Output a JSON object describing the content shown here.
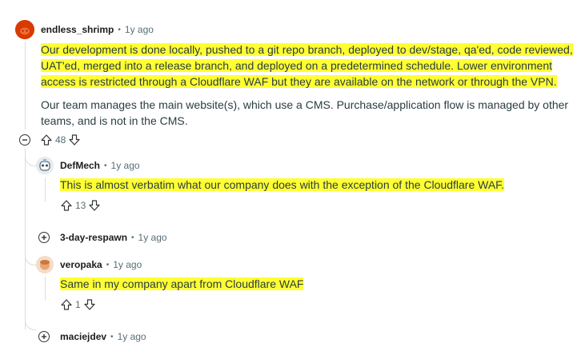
{
  "comments": [
    {
      "username": "endless_shrimp",
      "time": "1y ago",
      "para1_lines": [
        "Our development is done locally, pushed to a git repo branch, deployed to dev/stage, qa'ed, code reviewed,",
        "UAT'ed, merged into a release branch, and deployed on a predetermined schedule. Lower environment",
        "access is restricted through a Cloudflare WAF but they are available on the network or through the VPN."
      ],
      "para2_lines": [
        "Our team manages the main website(s), which use a CMS. Purchase/application flow is managed by other",
        "teams, and is not in the CMS."
      ],
      "votes": "48"
    },
    {
      "username": "DefMech",
      "time": "1y ago",
      "text": "This is almost verbatim what our company does with the exception of the Cloudflare WAF.",
      "votes": "13"
    },
    {
      "username": "3-day-respawn",
      "time": "1y ago"
    },
    {
      "username": "veropaka",
      "time": "1y ago",
      "text": "Same in my company apart from Cloudflare WAF",
      "votes": "1"
    },
    {
      "username": "maciejdev",
      "time": "1y ago"
    }
  ],
  "icons": {
    "upvote": "upvote-arrow-icon",
    "downvote": "downvote-arrow-icon",
    "collapse": "minus-circle-icon",
    "expand": "plus-circle-icon"
  },
  "colors": {
    "highlight": "#ffff33",
    "avatar_orange": "#d93a00",
    "meta_gray": "#576f76"
  }
}
